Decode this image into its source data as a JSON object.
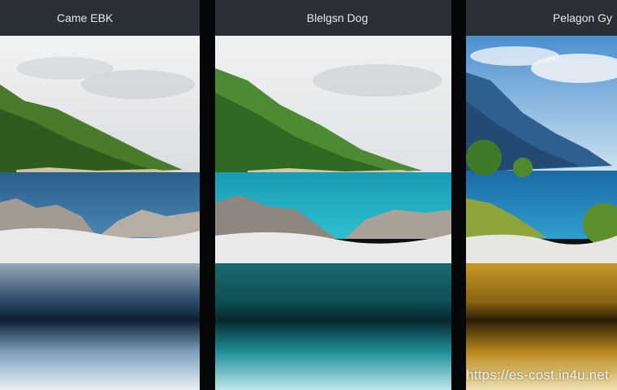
{
  "panels": [
    {
      "title": "Came EBK",
      "tint": "#1e3d5c"
    },
    {
      "title": "Blelgsn Dog",
      "tint": "#0d6e73"
    },
    {
      "title": "Pelagon Gy",
      "tint": "#9c7a14"
    }
  ],
  "watermark": "https://es-cost.in4u.net"
}
